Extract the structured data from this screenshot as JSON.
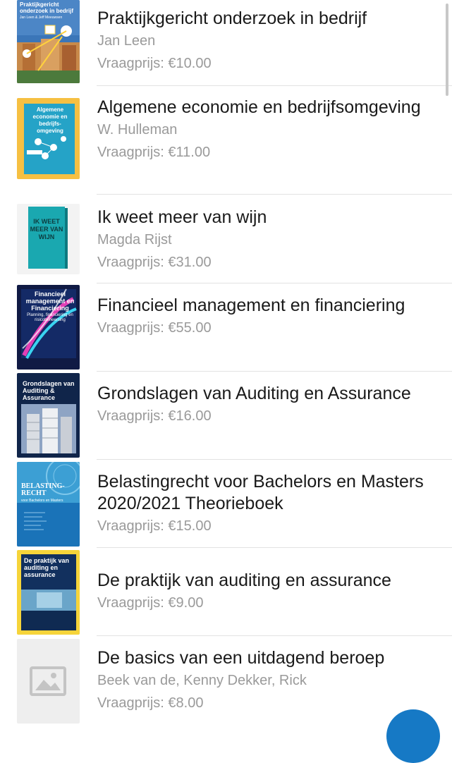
{
  "listings": [
    {
      "title": "Praktijkgericht onderzoek in bedrijf",
      "author": "Jan Leen",
      "price": "Vraagprijs: €10.00",
      "cover": {
        "icon": "book-cover-praktijkgericht",
        "text": "Praktijkgericht onderzoek in bedrijf",
        "sub": "Jan Leen & Jeff Meeuwsen"
      }
    },
    {
      "title": "Algemene economie en bedrijfsomgeving",
      "author": "W. Hulleman",
      "price": "Vraagprijs: €11.00",
      "cover": {
        "icon": "book-cover-algemene-economie",
        "text": "Algemene economie en bedrijfs-omgeving"
      }
    },
    {
      "title": "Ik weet meer van wijn",
      "author": "Magda Rijst",
      "price": "Vraagprijs: €31.00",
      "cover": {
        "icon": "book-cover-wijn",
        "text": "IK WEET MEER VAN WIJN"
      }
    },
    {
      "title": "Financieel management en financiering",
      "author": "",
      "price": "Vraagprijs: €55.00",
      "cover": {
        "icon": "book-cover-financieel-management",
        "text": "Financieel management en Financiering",
        "sub": "Planning, financiering en risicobeheersing"
      }
    },
    {
      "title": "Grondslagen van Auditing en Assurance",
      "author": "",
      "price": "Vraagprijs: €16.00",
      "cover": {
        "icon": "book-cover-grondslagen-auditing",
        "text": "Grondslagen van Auditing & Assurance"
      }
    },
    {
      "title": "Belastingrecht voor Bachelors en Masters 2020/2021 Theorieboek",
      "author": "",
      "price": "Vraagprijs: €15.00",
      "cover": {
        "icon": "book-cover-belastingrecht",
        "text": "BELASTING-RECHT",
        "sub": "voor Bachelors en Masters"
      }
    },
    {
      "title": "De praktijk van auditing en assurance",
      "author": "",
      "price": "Vraagprijs: €9.00",
      "cover": {
        "icon": "book-cover-praktijk-auditing",
        "text": "De praktijk van auditing en assurance"
      }
    },
    {
      "title": "De basics van een uitdagend beroep",
      "author": "Beek van de, Kenny Dekker, Rick",
      "price": "Vraagprijs: €8.00",
      "cover": {
        "icon": "image-placeholder-icon",
        "text": ""
      }
    }
  ],
  "colors": {
    "title": "#1a1a1a",
    "meta": "#9a9a9a",
    "fab": "#1679c5",
    "separator": "#e2e2e2"
  }
}
